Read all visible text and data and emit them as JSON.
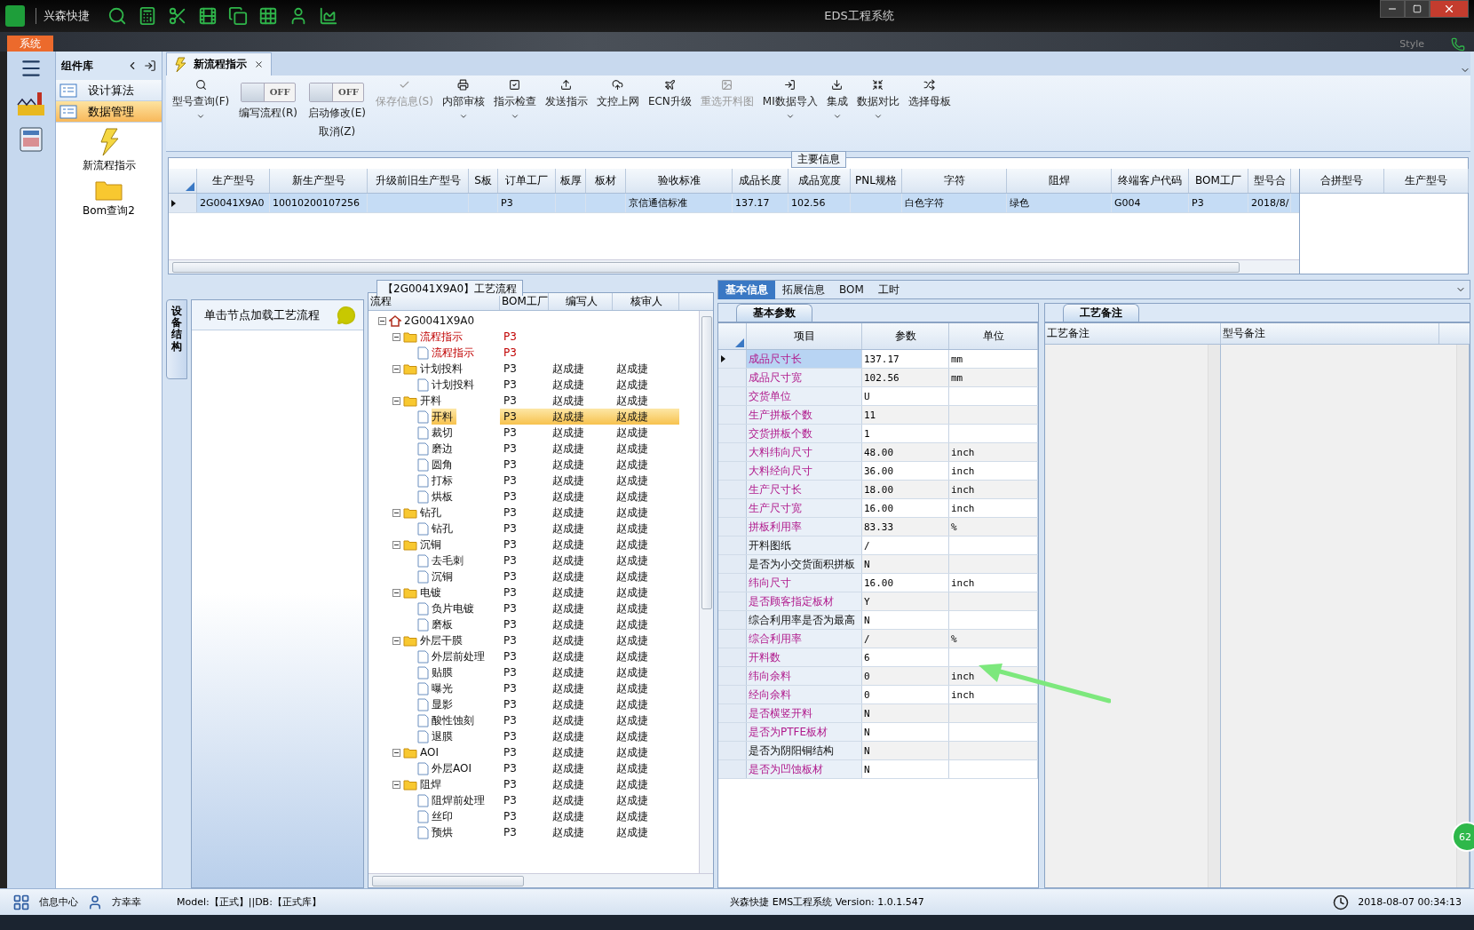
{
  "window": {
    "app_name": "兴森快捷",
    "title": "EDS工程系统",
    "menu_tab": "系统",
    "style_label": "Style"
  },
  "component_panel": {
    "title": "组件库",
    "groups": [
      {
        "label": "设计算法",
        "selected": false
      },
      {
        "label": "数据管理",
        "selected": true
      }
    ],
    "items": [
      {
        "label": "新流程指示",
        "kind": "bolt"
      },
      {
        "label": "Bom查询2",
        "kind": "folder"
      }
    ]
  },
  "doc_tabs": [
    {
      "label": "新流程指示",
      "selected": true
    }
  ],
  "toolbar": [
    {
      "kind": "button",
      "label": "型号查询(F)",
      "disabled": false,
      "dropdown": true
    },
    {
      "kind": "toggle",
      "label": "编写流程(R)",
      "state": "OFF",
      "on": false
    },
    {
      "kind": "toggle",
      "label": "启动修改(E)",
      "label2": "取消(Z)",
      "state": "OFF",
      "on": false
    },
    {
      "kind": "button",
      "label": "保存信息(S)",
      "disabled": true,
      "dropdown": false
    },
    {
      "kind": "button",
      "label": "内部审核",
      "disabled": false,
      "dropdown": true
    },
    {
      "kind": "button",
      "label": "指示检查",
      "disabled": false,
      "dropdown": true
    },
    {
      "kind": "button",
      "label": "发送指示",
      "disabled": false,
      "dropdown": false
    },
    {
      "kind": "button",
      "label": "文控上网",
      "disabled": false,
      "dropdown": false
    },
    {
      "kind": "button",
      "label": "ECN升级",
      "disabled": false,
      "dropdown": false
    },
    {
      "kind": "button",
      "label": "重选开料图",
      "disabled": true,
      "dropdown": false
    },
    {
      "kind": "button",
      "label": "MI数据导入",
      "disabled": false,
      "dropdown": true
    },
    {
      "kind": "button",
      "label": "集成",
      "disabled": false,
      "dropdown": true
    },
    {
      "kind": "button",
      "label": "数据对比",
      "disabled": false,
      "dropdown": true
    },
    {
      "kind": "button",
      "label": "选择母板",
      "disabled": false,
      "dropdown": false
    }
  ],
  "main_info": {
    "title": "主要信息",
    "columns": [
      "生产型号",
      "新生产型号",
      "升级前旧生产型号",
      "S板",
      "订单工厂",
      "板厚",
      "板材",
      "验收标准",
      "成品长度",
      "成品宽度",
      "PNL规格",
      "字符",
      "阻焊",
      "终端客户代码",
      "BOM工厂",
      "型号合"
    ],
    "rows": [
      {
        "selected": true,
        "cells": [
          "2G0041X9A0",
          "10010200107256",
          null,
          null,
          "P3",
          null,
          null,
          "京信通信标准",
          "137.17",
          "102.56",
          null,
          "白色字符",
          "绿色",
          "G004",
          "P3",
          "2018/8/"
        ]
      }
    ],
    "side_columns": [
      "合拼型号",
      "生产型号"
    ]
  },
  "equipment_tab": {
    "label": "设备结构"
  },
  "message_panel": {
    "text": "单击节点加载工艺流程"
  },
  "process_tree": {
    "title": "【2G0041X9A0】工艺流程",
    "columns": [
      "流程",
      "BOM工厂",
      "编写人",
      "核审人"
    ],
    "nodes": [
      {
        "label": "2G0041X9A0",
        "kind": "root",
        "flagged": false,
        "selected": false,
        "children": [
          {
            "label": "流程指示",
            "kind": "folder",
            "factory": "P3",
            "flagged": true,
            "selected": false,
            "children": [
              {
                "label": "流程指示",
                "kind": "page",
                "factory": "P3",
                "flagged": true,
                "selected": false
              }
            ]
          },
          {
            "label": "计划投料",
            "kind": "folder",
            "factory": "P3",
            "writer": "赵成捷",
            "reviewer": "赵成捷",
            "flagged": false,
            "selected": false,
            "children": [
              {
                "label": "计划投料",
                "kind": "page",
                "factory": "P3",
                "writer": "赵成捷",
                "reviewer": "赵成捷",
                "flagged": false,
                "selected": false
              }
            ]
          },
          {
            "label": "开料",
            "kind": "folder",
            "factory": "P3",
            "writer": "赵成捷",
            "reviewer": "赵成捷",
            "flagged": false,
            "selected": false,
            "children": [
              {
                "label": "开料",
                "kind": "page",
                "factory": "P3",
                "writer": "赵成捷",
                "reviewer": "赵成捷",
                "flagged": false,
                "selected": true
              },
              {
                "label": "裁切",
                "kind": "page",
                "factory": "P3",
                "writer": "赵成捷",
                "reviewer": "赵成捷",
                "flagged": false,
                "selected": false
              },
              {
                "label": "磨边",
                "kind": "page",
                "factory": "P3",
                "writer": "赵成捷",
                "reviewer": "赵成捷",
                "flagged": false,
                "selected": false
              },
              {
                "label": "圆角",
                "kind": "page",
                "factory": "P3",
                "writer": "赵成捷",
                "reviewer": "赵成捷",
                "flagged": false,
                "selected": false
              },
              {
                "label": "打标",
                "kind": "page",
                "factory": "P3",
                "writer": "赵成捷",
                "reviewer": "赵成捷",
                "flagged": false,
                "selected": false
              },
              {
                "label": "烘板",
                "kind": "page",
                "factory": "P3",
                "writer": "赵成捷",
                "reviewer": "赵成捷",
                "flagged": false,
                "selected": false
              }
            ]
          },
          {
            "label": "钻孔",
            "kind": "folder",
            "factory": "P3",
            "writer": "赵成捷",
            "reviewer": "赵成捷",
            "flagged": false,
            "selected": false,
            "children": [
              {
                "label": "钻孔",
                "kind": "page",
                "factory": "P3",
                "writer": "赵成捷",
                "reviewer": "赵成捷",
                "flagged": false,
                "selected": false
              }
            ]
          },
          {
            "label": "沉铜",
            "kind": "folder",
            "factory": "P3",
            "writer": "赵成捷",
            "reviewer": "赵成捷",
            "flagged": false,
            "selected": false,
            "children": [
              {
                "label": "去毛刺",
                "kind": "page",
                "factory": "P3",
                "writer": "赵成捷",
                "reviewer": "赵成捷",
                "flagged": false,
                "selected": false
              },
              {
                "label": "沉铜",
                "kind": "page",
                "factory": "P3",
                "writer": "赵成捷",
                "reviewer": "赵成捷",
                "flagged": false,
                "selected": false
              }
            ]
          },
          {
            "label": "电镀",
            "kind": "folder",
            "factory": "P3",
            "writer": "赵成捷",
            "reviewer": "赵成捷",
            "flagged": false,
            "selected": false,
            "children": [
              {
                "label": "负片电镀",
                "kind": "page",
                "factory": "P3",
                "writer": "赵成捷",
                "reviewer": "赵成捷",
                "flagged": false,
                "selected": false
              },
              {
                "label": "磨板",
                "kind": "page",
                "factory": "P3",
                "writer": "赵成捷",
                "reviewer": "赵成捷",
                "flagged": false,
                "selected": false
              }
            ]
          },
          {
            "label": "外层干膜",
            "kind": "folder",
            "factory": "P3",
            "writer": "赵成捷",
            "reviewer": "赵成捷",
            "flagged": false,
            "selected": false,
            "children": [
              {
                "label": "外层前处理",
                "kind": "page",
                "factory": "P3",
                "writer": "赵成捷",
                "reviewer": "赵成捷",
                "flagged": false,
                "selected": false
              },
              {
                "label": "贴膜",
                "kind": "page",
                "factory": "P3",
                "writer": "赵成捷",
                "reviewer": "赵成捷",
                "flagged": false,
                "selected": false
              },
              {
                "label": "曝光",
                "kind": "page",
                "factory": "P3",
                "writer": "赵成捷",
                "reviewer": "赵成捷",
                "flagged": false,
                "selected": false
              },
              {
                "label": "显影",
                "kind": "page",
                "factory": "P3",
                "writer": "赵成捷",
                "reviewer": "赵成捷",
                "flagged": false,
                "selected": false
              },
              {
                "label": "酸性蚀刻",
                "kind": "page",
                "factory": "P3",
                "writer": "赵成捷",
                "reviewer": "赵成捷",
                "flagged": false,
                "selected": false
              },
              {
                "label": "退膜",
                "kind": "page",
                "factory": "P3",
                "writer": "赵成捷",
                "reviewer": "赵成捷",
                "flagged": false,
                "selected": false
              }
            ]
          },
          {
            "label": "AOI",
            "kind": "folder",
            "factory": "P3",
            "writer": "赵成捷",
            "reviewer": "赵成捷",
            "flagged": false,
            "selected": false,
            "children": [
              {
                "label": "外层AOI",
                "kind": "page",
                "factory": "P3",
                "writer": "赵成捷",
                "reviewer": "赵成捷",
                "flagged": false,
                "selected": false
              }
            ]
          },
          {
            "label": "阻焊",
            "kind": "folder",
            "factory": "P3",
            "writer": "赵成捷",
            "reviewer": "赵成捷",
            "flagged": false,
            "selected": false,
            "children": [
              {
                "label": "阻焊前处理",
                "kind": "page",
                "factory": "P3",
                "writer": "赵成捷",
                "reviewer": "赵成捷",
                "flagged": false,
                "selected": false
              },
              {
                "label": "丝印",
                "kind": "page",
                "factory": "P3",
                "writer": "赵成捷",
                "reviewer": "赵成捷",
                "flagged": false,
                "selected": false
              },
              {
                "label": "预烘",
                "kind": "page",
                "factory": "P3",
                "writer": "赵成捷",
                "reviewer": "赵成捷",
                "flagged": false,
                "selected": false
              }
            ]
          }
        ]
      }
    ]
  },
  "detail_tabs": [
    {
      "label": "基本信息",
      "selected": true
    },
    {
      "label": "拓展信息",
      "selected": false
    },
    {
      "label": "BOM",
      "selected": false
    },
    {
      "label": "工时",
      "selected": false
    }
  ],
  "basic_params": {
    "tab": "基本参数",
    "columns": [
      "项目",
      "参数",
      "单位"
    ],
    "rows": [
      {
        "name": "成品尺寸长",
        "value": "137.17",
        "unit": "mm",
        "required": true,
        "selected": true
      },
      {
        "name": "成品尺寸宽",
        "value": "102.56",
        "unit": "mm",
        "required": true,
        "selected": false
      },
      {
        "name": "交货单位",
        "value": "U",
        "required": true,
        "selected": false
      },
      {
        "name": "生产拼板个数",
        "value": "11",
        "required": true,
        "selected": false
      },
      {
        "name": "交货拼板个数",
        "value": "1",
        "required": true,
        "selected": false
      },
      {
        "name": "大料纬向尺寸",
        "value": "48.00",
        "unit": "inch",
        "required": true,
        "selected": false
      },
      {
        "name": "大料经向尺寸",
        "value": "36.00",
        "unit": "inch",
        "required": true,
        "selected": false
      },
      {
        "name": "生产尺寸长",
        "value": "18.00",
        "unit": "inch",
        "required": true,
        "selected": false
      },
      {
        "name": "生产尺寸宽",
        "value": "16.00",
        "unit": "inch",
        "required": true,
        "selected": false
      },
      {
        "name": "拼板利用率",
        "value": "83.33",
        "unit": "%",
        "required": true,
        "selected": false
      },
      {
        "name": "开料图纸",
        "value": "/",
        "required": false,
        "selected": false
      },
      {
        "name": "是否为小交货面积拼板",
        "value": "N",
        "required": false,
        "selected": false
      },
      {
        "name": "纬向尺寸",
        "value": "16.00",
        "unit": "inch",
        "required": true,
        "selected": false
      },
      {
        "name": "是否顾客指定板材",
        "value": "Y",
        "required": true,
        "selected": false
      },
      {
        "name": "综合利用率是否为最高",
        "value": "N",
        "required": false,
        "selected": false
      },
      {
        "name": "综合利用率",
        "value": "/",
        "unit": "%",
        "required": true,
        "selected": false
      },
      {
        "name": "开料数",
        "value": "6",
        "required": true,
        "selected": false
      },
      {
        "name": "纬向余料",
        "value": "0",
        "unit": "inch",
        "required": true,
        "selected": false
      },
      {
        "name": "经向余料",
        "value": "0",
        "unit": "inch",
        "required": true,
        "selected": false
      },
      {
        "name": "是否横竖开料",
        "value": "N",
        "required": true,
        "selected": false
      },
      {
        "name": "是否为PTFE板材",
        "value": "N",
        "required": true,
        "selected": false
      },
      {
        "name": "是否为阴阳铜结构",
        "value": "N",
        "required": false,
        "selected": false
      },
      {
        "name": "是否为凹蚀板材",
        "value": "N",
        "required": true,
        "selected": false
      }
    ]
  },
  "remarks": {
    "tab": "工艺备注",
    "columns": [
      "工艺备注",
      "型号备注"
    ]
  },
  "floating_badge": {
    "text": "62"
  },
  "status_bar": {
    "info_center": "信息中心",
    "user": "方幸幸",
    "model": "Model:【正式】||DB:【正式库】",
    "version": "兴森快捷 EMS工程系统 Version: 1.0.1.547",
    "time": "2018-08-07 00:34:13"
  }
}
